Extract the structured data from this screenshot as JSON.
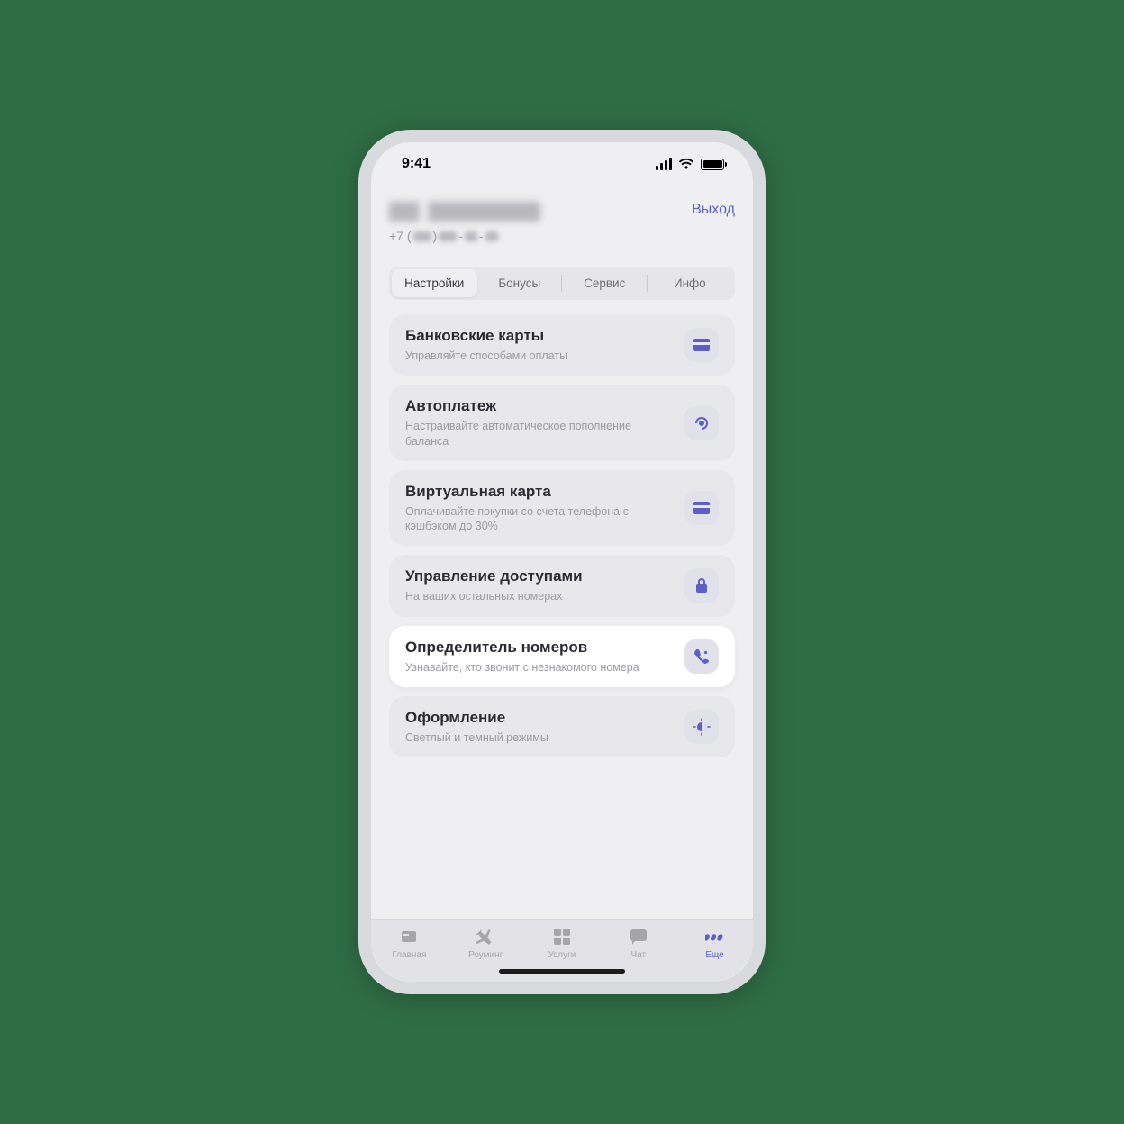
{
  "status": {
    "time": "9:41"
  },
  "header": {
    "phone_prefix": "+7 (",
    "logout": "Выход"
  },
  "segments": [
    {
      "label": "Настройки",
      "active": true
    },
    {
      "label": "Бонусы",
      "active": false
    },
    {
      "label": "Сервис",
      "active": false
    },
    {
      "label": "Инфо",
      "active": false
    }
  ],
  "cards": [
    {
      "title": "Банковские карты",
      "subtitle": "Управляйте способами оплаты",
      "icon": "credit-card",
      "highlight": false
    },
    {
      "title": "Автоплатеж",
      "subtitle": "Настраивайте автоматическое пополнение баланса",
      "icon": "auto",
      "highlight": false
    },
    {
      "title": "Виртуальная карта",
      "subtitle": "Оплачивайте покупки со счета телефона с кэшбэком до 30%",
      "icon": "credit-card",
      "highlight": false
    },
    {
      "title": "Управление доступами",
      "subtitle": "На ваших остальных номерах",
      "icon": "lock",
      "highlight": false
    },
    {
      "title": "Определитель номеров",
      "subtitle": "Узнавайте, кто звонит с незнакомого номера",
      "icon": "call",
      "highlight": true
    },
    {
      "title": "Оформление",
      "subtitle": "Светлый и темный режимы",
      "icon": "theme",
      "highlight": false
    }
  ],
  "tabs": [
    {
      "label": "Главная",
      "icon": "home",
      "active": false
    },
    {
      "label": "Роуминг",
      "icon": "plane",
      "active": false
    },
    {
      "label": "Услуги",
      "icon": "grid",
      "active": false
    },
    {
      "label": "Чат",
      "icon": "chat",
      "active": false
    },
    {
      "label": "Еще",
      "icon": "more",
      "active": true
    }
  ]
}
